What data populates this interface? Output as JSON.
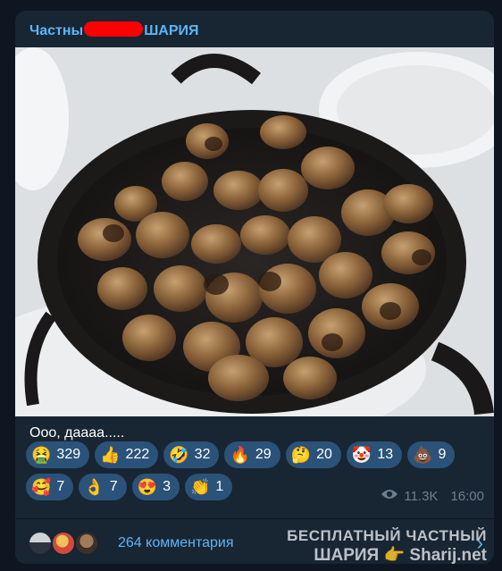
{
  "post": {
    "channel_name_start": "Частны",
    "channel_name_end": "ШАРИЯ",
    "caption": "Ооо, даааа.....",
    "views": "11.3K",
    "time": "16:00"
  },
  "reactions": [
    {
      "icon": "nauseated-face-icon",
      "emoji": "🤮",
      "count": "329"
    },
    {
      "icon": "thumbs-up-icon",
      "emoji": "👍",
      "count": "222"
    },
    {
      "icon": "rofl-icon",
      "emoji": "🤣",
      "count": "32"
    },
    {
      "icon": "fire-icon",
      "emoji": "🔥",
      "count": "29"
    },
    {
      "icon": "thinking-face-icon",
      "emoji": "🤔",
      "count": "20"
    },
    {
      "icon": "clown-face-icon",
      "emoji": "🤡",
      "count": "13"
    },
    {
      "icon": "poo-icon",
      "emoji": "💩",
      "count": "9"
    },
    {
      "icon": "smiling-hearts-face-icon",
      "emoji": "🥰",
      "count": "7"
    },
    {
      "icon": "ok-hand-icon",
      "emoji": "👌",
      "count": "7"
    },
    {
      "icon": "heart-eyes-icon",
      "emoji": "😍",
      "count": "3"
    },
    {
      "icon": "clapping-hands-icon",
      "emoji": "👏",
      "count": "1"
    }
  ],
  "footer": {
    "comments_label": "264 комментария",
    "watermark_line1": "БЕСПЛАТНЫЙ ЧАСТНЫЙ",
    "watermark_line2": "ШАРИЯ 👉 Sharij.net"
  },
  "colors": {
    "background": "#0e1621",
    "bubble": "#182533",
    "accent": "#5eb5f7",
    "chip": "#2b5278"
  }
}
